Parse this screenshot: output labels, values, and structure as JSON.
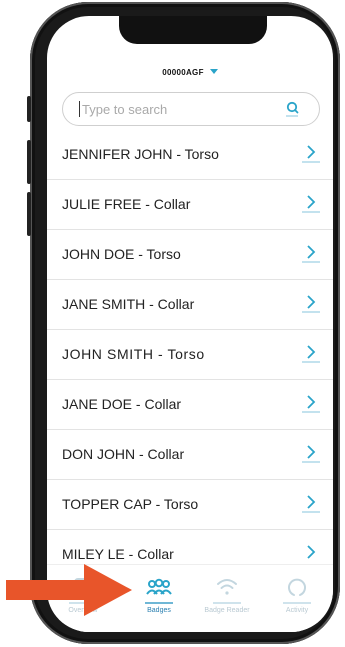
{
  "header": {
    "account_id": "00000AGF"
  },
  "search": {
    "placeholder": "Type to search"
  },
  "badges": [
    {
      "label": "JENNIFER JOHN - Torso"
    },
    {
      "label": "JULIE FREE - Collar"
    },
    {
      "label": "JOHN DOE - Torso"
    },
    {
      "label": "JANE SMITH - Collar"
    },
    {
      "label": "JOHN SMITH - Torso"
    },
    {
      "label": "JANE DOE - Collar"
    },
    {
      "label": "DON JOHN - Collar"
    },
    {
      "label": "TOPPER CAP - Torso"
    },
    {
      "label": "MILEY LE - Collar"
    }
  ],
  "tabs": [
    {
      "label": "Overview",
      "icon": "overview-icon",
      "active": false
    },
    {
      "label": "Badges",
      "icon": "people-icon",
      "active": true
    },
    {
      "label": "Badge Reader",
      "icon": "wifi-icon",
      "active": false
    },
    {
      "label": "Activity",
      "icon": "activity-icon",
      "active": false
    }
  ],
  "colors": {
    "accent": "#2aa4c9",
    "active_tab": "#2a7fb0",
    "annotation_arrow": "#e8552a"
  }
}
